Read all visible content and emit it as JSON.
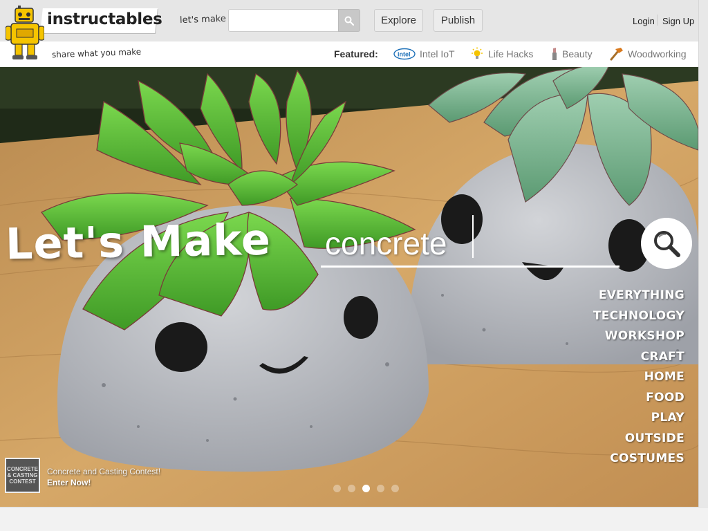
{
  "header": {
    "logo_text": "instructables",
    "lets_make": "let's make",
    "search_placeholder": "",
    "explore_label": "Explore",
    "publish_label": "Publish",
    "login_label": "Login",
    "signup_label": "Sign Up"
  },
  "subheader": {
    "tagline": "share what you make",
    "featured_label": "Featured:",
    "featured_items": [
      {
        "label": "Intel IoT",
        "icon": "intel-logo-icon"
      },
      {
        "label": "Life Hacks",
        "icon": "lightbulb-icon"
      },
      {
        "label": "Beauty",
        "icon": "lipstick-icon"
      },
      {
        "label": "Woodworking",
        "icon": "hammer-icon"
      }
    ]
  },
  "hero": {
    "title": "Let's Make",
    "query": "concrete",
    "channels": [
      "EVERYTHING",
      "TECHNOLOGY",
      "WORKSHOP",
      "CRAFT",
      "HOME",
      "FOOD",
      "PLAY",
      "OUTSIDE",
      "COSTUMES"
    ],
    "contest_thumb_text": "CONCRETE & CASTING CONTEST",
    "contest_title": "Concrete and Casting Contest!",
    "contest_cta": "Enter Now!",
    "slide_count": 5,
    "active_slide": 3
  },
  "colors": {
    "topbar": "#e6e6e6",
    "logo_yellow": "#f5c400",
    "succulent_green": "#5cc33a",
    "concrete_gray": "#b9bcc2",
    "wood": "#c99a5e"
  }
}
